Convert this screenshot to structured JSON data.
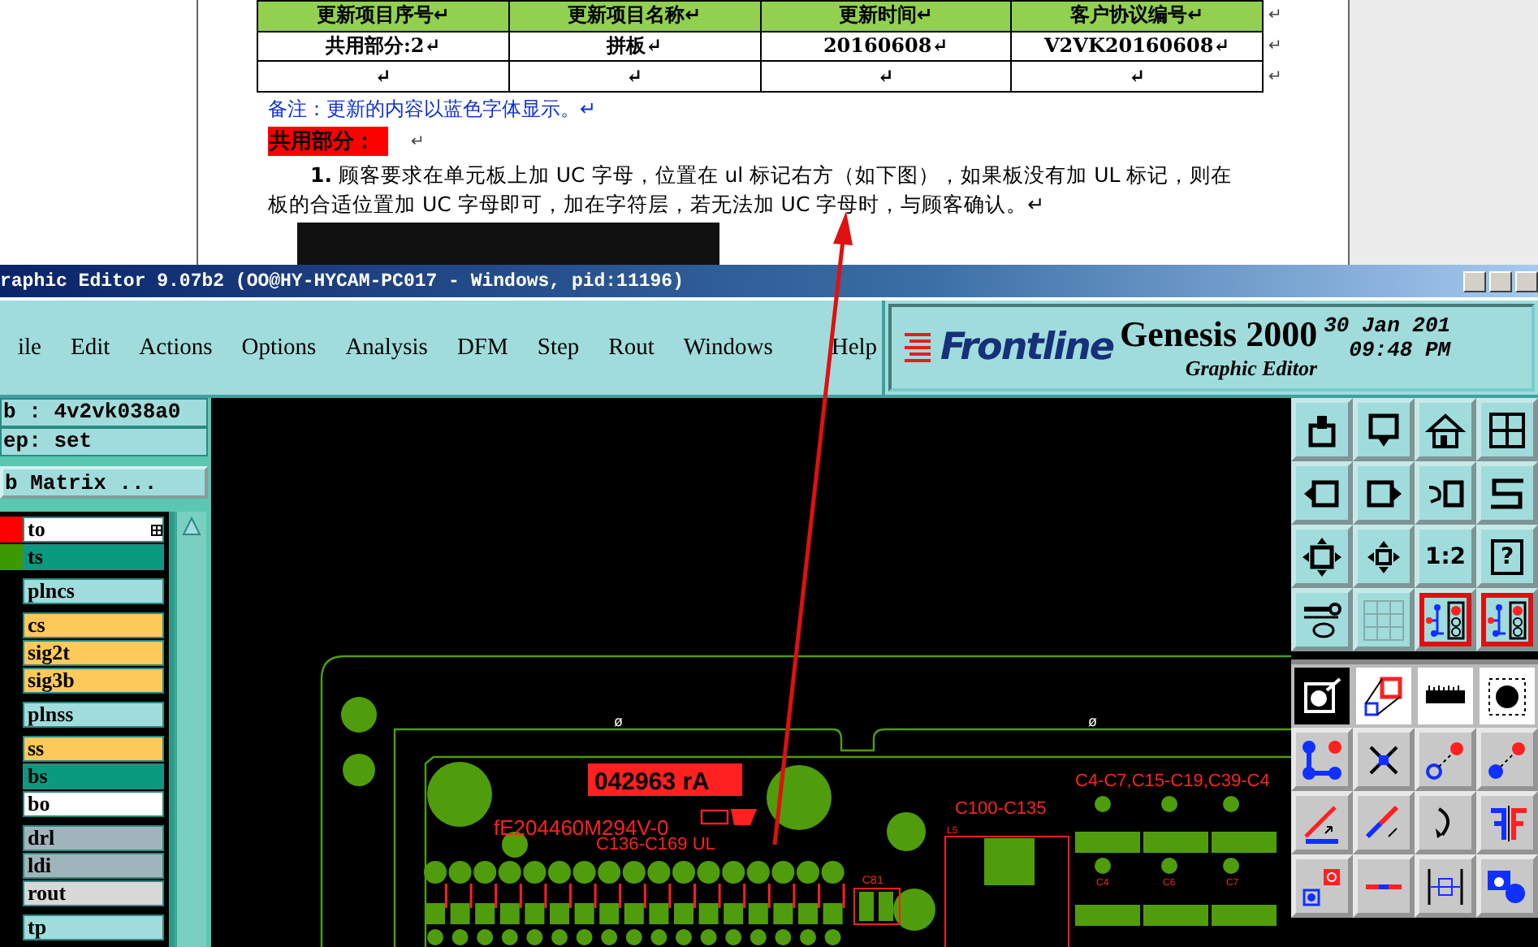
{
  "document": {
    "table": {
      "columns": [
        "更新项目序号↵",
        "更新项目名称↵",
        "更新时间↵",
        "客户协议编号↵"
      ],
      "rows": [
        [
          "共用部分:2↵",
          "拼板↵",
          "20160608↵",
          "V2VK20160608↵"
        ],
        [
          "↵",
          "↵",
          "↵",
          "↵"
        ]
      ],
      "row_marks": [
        "↵",
        "↵",
        "↵"
      ]
    },
    "note": "备注：更新的内容以蓝色字体显示。↵",
    "heading": "共用部分：",
    "heading_mark": "↵",
    "paragraph": "**1.** 顾客要求在单元板上加 UC 字母，位置在 ul 标记右方（如下图），如果板没有加 UL 标记，则在板的合适位置加 UC 字母即可，加在字符层，若无法加 UC 字母时，与顾客确认。↵"
  },
  "window": {
    "title": "raphic Editor 9.07b2 (OO@HY-HYCAM-PC017 - Windows, pid:11196)"
  },
  "menu": [
    "ile",
    "Edit",
    "Actions",
    "Options",
    "Analysis",
    "DFM",
    "Step",
    "Rout",
    "Windows",
    "Help"
  ],
  "brand": {
    "logo": "Frontline",
    "product": "Genesis 2000",
    "subtitle": "Graphic Editor",
    "date": "30 Jan 201",
    "time": "09:48 PM"
  },
  "left_panel": {
    "job": "b : 4v2vk038a0",
    "step": "ep: set",
    "matrix_button": "b Matrix ...",
    "layer_groups": [
      [
        {
          "name": "to",
          "color": "#ffffff",
          "swatch": {
            "color": "#ff0000"
          }
        },
        {
          "name": "ts",
          "color": "#0a9a80",
          "swatch": {
            "color": "#3c9a00"
          }
        }
      ],
      [
        {
          "name": "plncs",
          "color": "#a0dcdc"
        }
      ],
      [
        {
          "name": "cs",
          "color": "#fcc95a"
        },
        {
          "name": "sig2t",
          "color": "#fcc95a"
        },
        {
          "name": "sig3b",
          "color": "#fcc95a"
        }
      ],
      [
        {
          "name": "plnss",
          "color": "#a0dcdc"
        }
      ],
      [
        {
          "name": "ss",
          "color": "#fcc95a"
        },
        {
          "name": "bs",
          "color": "#0a9a80"
        },
        {
          "name": "bo",
          "color": "#ffffff"
        }
      ],
      [
        {
          "name": "drl",
          "color": "#a0b4bc"
        },
        {
          "name": "ldi",
          "color": "#a0b4bc"
        },
        {
          "name": "rout",
          "color": "#d8d8d8"
        }
      ],
      [
        {
          "name": "tp",
          "color": "#a0dcdc"
        }
      ]
    ]
  },
  "canvas": {
    "labels": [
      "ø",
      "ø",
      "042963 rA",
      "fE204460M294V-0",
      "C136-C169 UL",
      "C81",
      "C100-C135",
      "L5",
      "C4-C7,C15-C19,C39-C4",
      "C4",
      "C6",
      "C7"
    ]
  },
  "toolbar": {
    "rows": [
      {
        "kind": "teal",
        "tools": [
          {
            "kind": "up-box",
            "selected": false
          },
          {
            "kind": "down-box",
            "selected": false
          },
          {
            "kind": "house",
            "selected": false
          },
          {
            "kind": "grid-xy",
            "selected": false
          }
        ]
      },
      {
        "kind": "teal",
        "tools": [
          {
            "kind": "left-box",
            "selected": false
          },
          {
            "kind": "right-box",
            "selected": false
          },
          {
            "kind": "undo-box",
            "selected": false
          },
          {
            "kind": "snake",
            "selected": false
          }
        ]
      },
      {
        "kind": "teal",
        "tools": [
          {
            "kind": "expand",
            "selected": false
          },
          {
            "kind": "shrink",
            "selected": false
          },
          {
            "kind": "text",
            "label": "1:2",
            "selected": false
          },
          {
            "kind": "text-box",
            "label": "?",
            "selected": false
          }
        ]
      },
      {
        "kind": "teal",
        "tools": [
          {
            "kind": "tools",
            "selected": false
          },
          {
            "kind": "grid",
            "selected": false
          },
          {
            "kind": "circuit",
            "selected": true
          },
          {
            "kind": "circuit",
            "selected": true
          }
        ]
      },
      {
        "kind": "white",
        "tools": [
          {
            "kind": "pad-select",
            "selected": true
          },
          {
            "kind": "zoom-region",
            "selected": false
          },
          {
            "kind": "ruler",
            "selected": false
          },
          {
            "kind": "dot-dashed",
            "selected": false
          }
        ]
      },
      {
        "kind": "grey",
        "tools": [
          {
            "kind": "nodes",
            "selected": false
          },
          {
            "kind": "cross",
            "selected": false
          },
          {
            "kind": "hollow-red",
            "selected": false
          },
          {
            "kind": "blue-red",
            "selected": false
          }
        ]
      },
      {
        "kind": "grey",
        "tools": [
          {
            "kind": "angle",
            "selected": false
          },
          {
            "kind": "diag",
            "selected": false
          },
          {
            "kind": "curve",
            "selected": false
          },
          {
            "kind": "mirror",
            "selected": false
          }
        ]
      },
      {
        "kind": "grey",
        "tools": [
          {
            "kind": "pad-move",
            "selected": false
          },
          {
            "kind": "line-mid",
            "selected": false
          },
          {
            "kind": "measure",
            "selected": false
          },
          {
            "kind": "blue-shapes",
            "selected": false
          }
        ]
      }
    ]
  }
}
